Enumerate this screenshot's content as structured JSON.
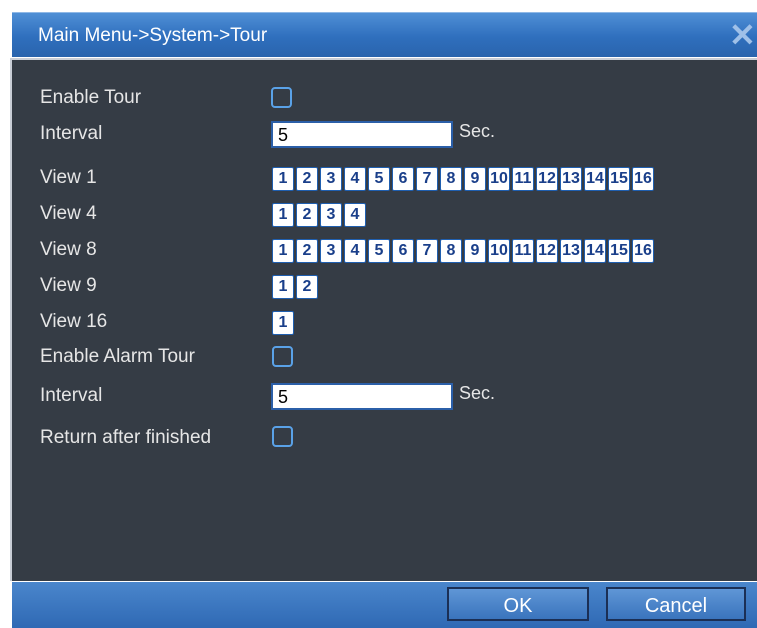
{
  "window": {
    "title": "Main Menu->System->Tour"
  },
  "form": {
    "enable_tour_label": "Enable Tour",
    "interval_label": "Interval",
    "interval_value": "5",
    "interval_unit": "Sec.",
    "view1_label": "View 1",
    "view4_label": "View 4",
    "view8_label": "View 8",
    "view9_label": "View 9",
    "view16_label": "View 16",
    "enable_alarm_tour_label": "Enable Alarm Tour",
    "alarm_interval_label": "Interval",
    "alarm_interval_value": "5",
    "alarm_interval_unit": "Sec.",
    "return_after_finished_label": "Return after finished"
  },
  "views": {
    "view1": [
      "1",
      "2",
      "3",
      "4",
      "5",
      "6",
      "7",
      "8",
      "9",
      "10",
      "11",
      "12",
      "13",
      "14",
      "15",
      "16"
    ],
    "view4": [
      "1",
      "2",
      "3",
      "4"
    ],
    "view8": [
      "1",
      "2",
      "3",
      "4",
      "5",
      "6",
      "7",
      "8",
      "9",
      "10",
      "11",
      "12",
      "13",
      "14",
      "15",
      "16"
    ],
    "view9": [
      "1",
      "2"
    ],
    "view16": [
      "1"
    ]
  },
  "buttons": {
    "ok": "OK",
    "cancel": "Cancel"
  },
  "icons": {
    "close": "close-icon"
  }
}
